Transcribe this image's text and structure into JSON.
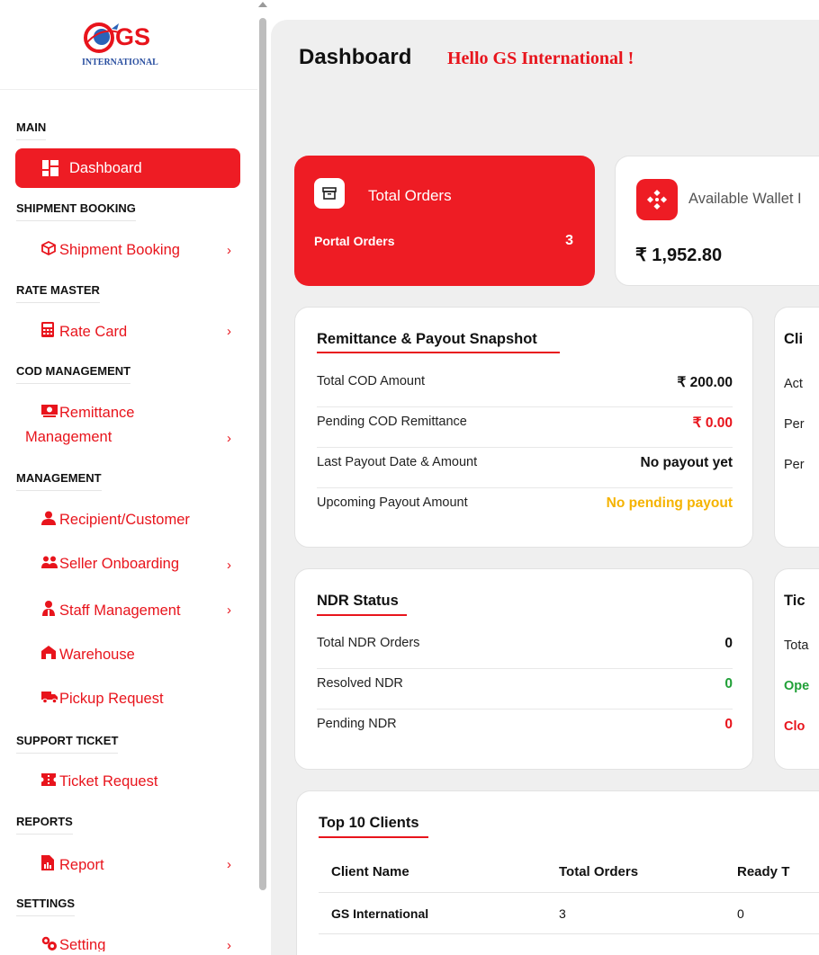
{
  "brand": {
    "logo_text": "GS",
    "logo_sub": "INTERNATIONAL"
  },
  "sidebar": {
    "sections": [
      {
        "label": "MAIN"
      },
      {
        "label": "SHIPMENT BOOKING"
      },
      {
        "label": "RATE MASTER"
      },
      {
        "label": "COD MANAGEMENT"
      },
      {
        "label": "MANAGEMENT"
      },
      {
        "label": "SUPPORT TICKET"
      },
      {
        "label": "REPORTS"
      },
      {
        "label": "SETTINGS"
      }
    ],
    "items": [
      {
        "label": "Dashboard",
        "icon": "dashboard-icon",
        "active": true
      },
      {
        "label": "Shipment Booking",
        "icon": "box-icon"
      },
      {
        "label": "Rate Card",
        "icon": "calculator-icon"
      },
      {
        "label": "Remittance",
        "label2": "Management",
        "icon": "money-icon"
      },
      {
        "label": "Recipient/Customer",
        "icon": "user-icon"
      },
      {
        "label": "Seller Onboarding",
        "icon": "users-icon"
      },
      {
        "label": "Staff Management",
        "icon": "staff-icon"
      },
      {
        "label": "Warehouse",
        "icon": "warehouse-icon"
      },
      {
        "label": "Pickup Request",
        "icon": "truck-icon"
      },
      {
        "label": "Ticket Request",
        "icon": "ticket-icon"
      },
      {
        "label": "Report",
        "icon": "report-icon"
      },
      {
        "label": "Setting",
        "icon": "settings-icon"
      }
    ],
    "chevron": "›"
  },
  "header": {
    "title": "Dashboard",
    "greeting": "Hello GS International !"
  },
  "stats": {
    "total_orders": {
      "title": "Total Orders",
      "sub_label": "Portal Orders",
      "value": "3"
    },
    "wallet": {
      "title": "Available Wallet I",
      "value": "₹ 1,952.80"
    }
  },
  "remittance": {
    "title": "Remittance & Payout Snapshot",
    "rows": [
      {
        "label": "Total COD Amount",
        "value": "₹ 200.00"
      },
      {
        "label": "Pending COD Remittance",
        "value": "₹ 0.00"
      },
      {
        "label": "Last Payout Date & Amount",
        "value": "No payout yet"
      },
      {
        "label": "Upcoming Payout Amount",
        "value": "No pending payout"
      }
    ]
  },
  "clients_card": {
    "title": "Cli",
    "rows": [
      "Act",
      "Per",
      "Per"
    ]
  },
  "ndr": {
    "title": "NDR Status",
    "rows": [
      {
        "label": "Total NDR Orders",
        "value": "0"
      },
      {
        "label": "Resolved NDR",
        "value": "0"
      },
      {
        "label": "Pending NDR",
        "value": "0"
      }
    ]
  },
  "tickets_card": {
    "title": "Tic",
    "rows": [
      "Tota",
      "Ope",
      "Clo"
    ]
  },
  "top_clients": {
    "title": "Top 10 Clients",
    "columns": [
      "Client Name",
      "Total Orders",
      "Ready T"
    ],
    "rows": [
      [
        "GS International",
        "3",
        "0"
      ]
    ]
  },
  "colors": {
    "accent": "#ee1c24",
    "green": "#21a038",
    "amber": "#f5b301"
  }
}
